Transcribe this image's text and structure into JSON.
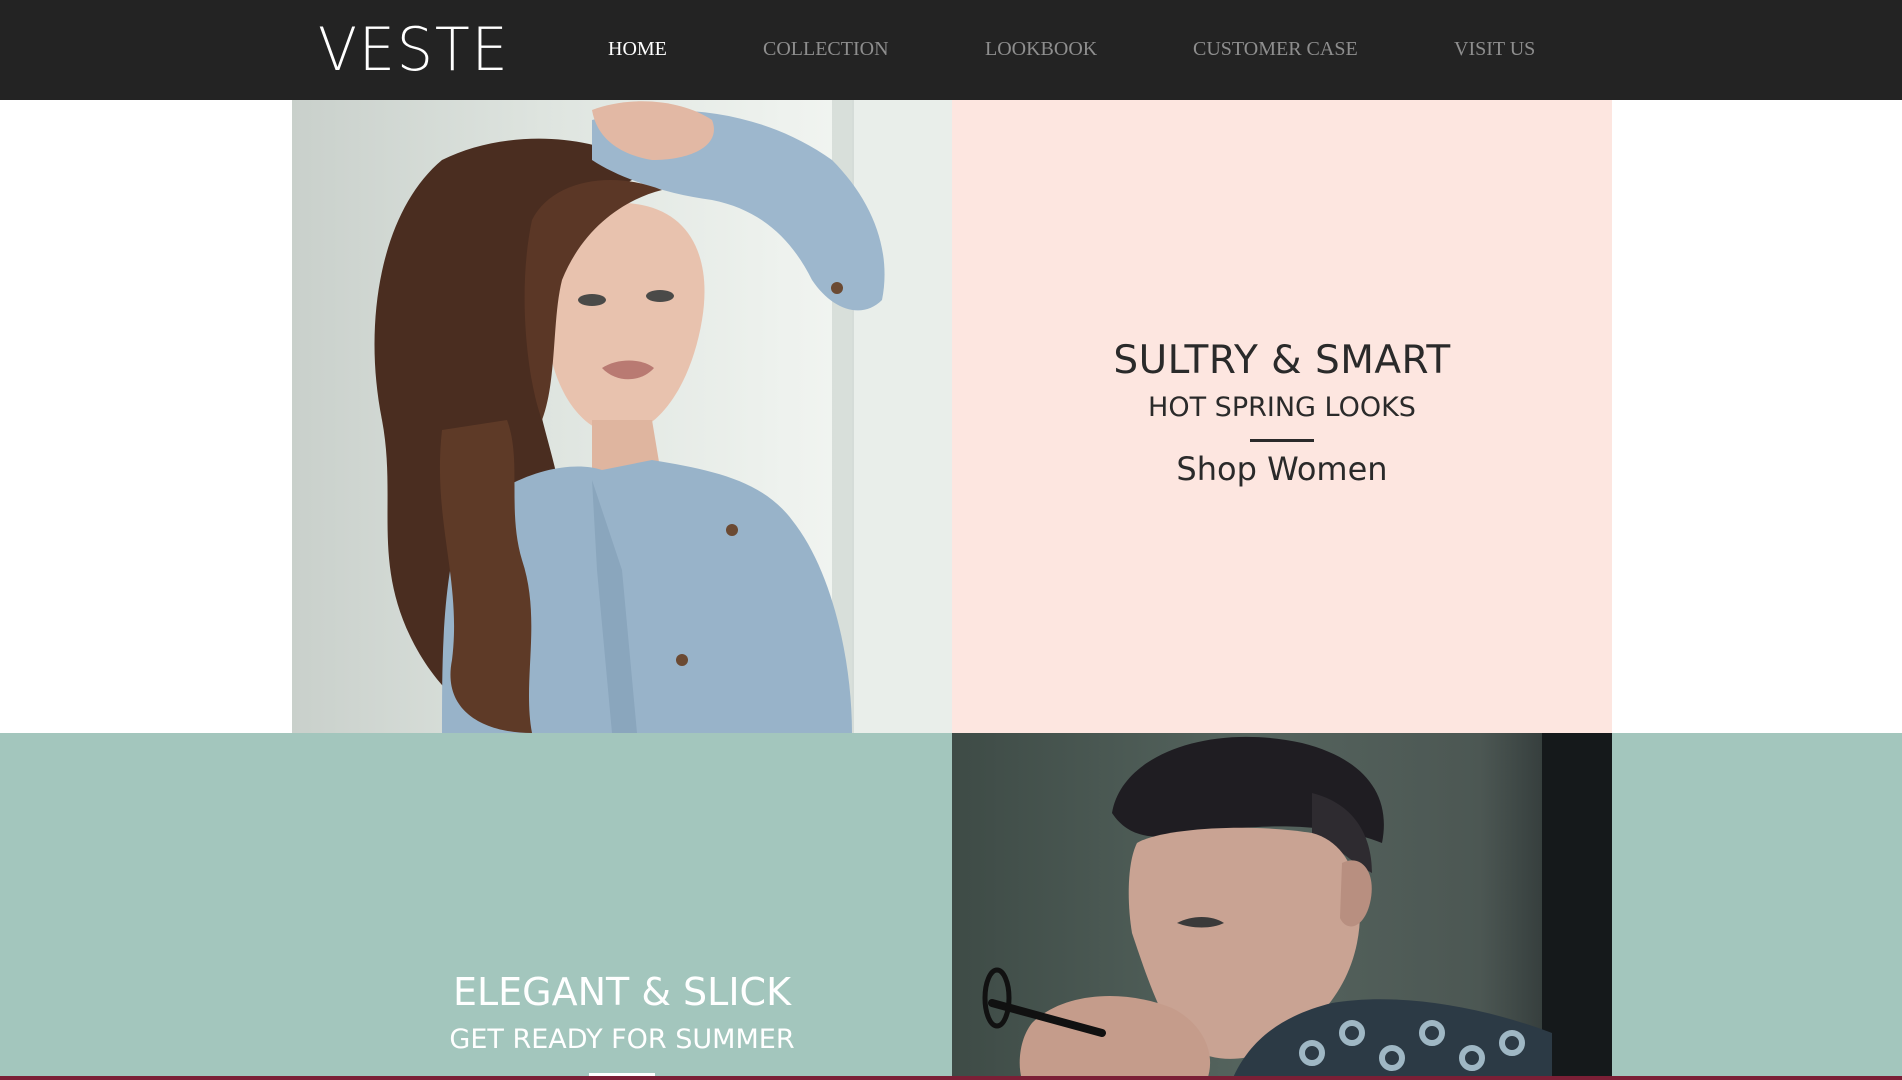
{
  "header": {
    "logo": "VESTE",
    "nav": [
      {
        "label": "HOME",
        "active": true
      },
      {
        "label": "COLLECTION",
        "active": false
      },
      {
        "label": "LOOKBOOK",
        "active": false
      },
      {
        "label": "CUSTOMER CASE",
        "active": false
      },
      {
        "label": "VISIT US",
        "active": false
      }
    ]
  },
  "women": {
    "title": "SULTRY & SMART",
    "subtitle": "HOT SPRING LOOKS",
    "cta": "Shop Women"
  },
  "men": {
    "title": "ELEGANT & SLICK",
    "subtitle": "GET READY FOR SUMMER"
  },
  "colors": {
    "header_bg": "#232323",
    "pink_panel": "#fde6e0",
    "teal_band": "#a3c6bd"
  }
}
